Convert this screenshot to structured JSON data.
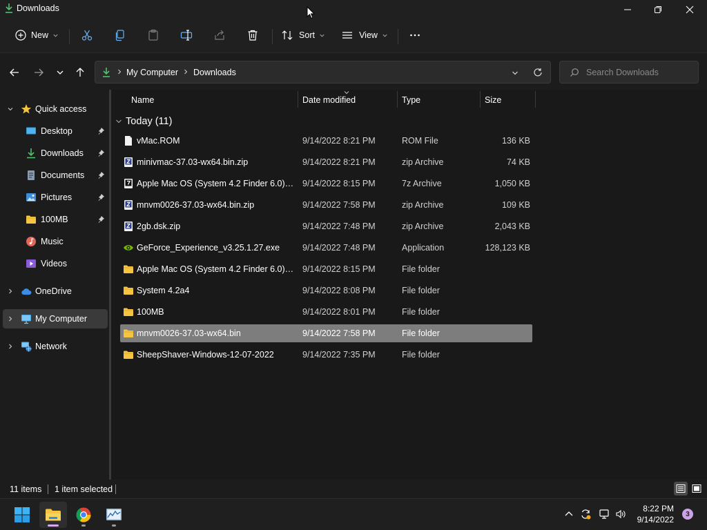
{
  "window": {
    "title": "Downloads"
  },
  "toolbar": {
    "new_label": "New",
    "sort_label": "Sort",
    "view_label": "View"
  },
  "address": {
    "crumbs": [
      "My Computer",
      "Downloads"
    ],
    "search_placeholder": "Search Downloads"
  },
  "sidebar": {
    "items": [
      {
        "label": "Quick access",
        "icon": "star-icon"
      },
      {
        "label": "Desktop",
        "icon": "desktop-icon",
        "pinned": true
      },
      {
        "label": "Downloads",
        "icon": "download-icon",
        "pinned": true
      },
      {
        "label": "Documents",
        "icon": "document-icon",
        "pinned": true
      },
      {
        "label": "Pictures",
        "icon": "pictures-icon",
        "pinned": true
      },
      {
        "label": "100MB",
        "icon": "folder-icon",
        "pinned": true
      },
      {
        "label": "Music",
        "icon": "music-icon"
      },
      {
        "label": "Videos",
        "icon": "videos-icon"
      },
      {
        "label": "OneDrive",
        "icon": "cloud-icon"
      },
      {
        "label": "My Computer",
        "icon": "computer-icon",
        "selected": true
      },
      {
        "label": "Network",
        "icon": "network-icon"
      }
    ]
  },
  "columns": {
    "name": "Name",
    "date": "Date modified",
    "type": "Type",
    "size": "Size"
  },
  "group": {
    "label": "Today (11)"
  },
  "files": [
    {
      "name": "vMac.ROM",
      "date": "9/14/2022 8:21 PM",
      "type": "ROM File",
      "size": "136 KB",
      "icon": "file-icon"
    },
    {
      "name": "minivmac-37.03-wx64.bin.zip",
      "date": "9/14/2022 8:21 PM",
      "type": "zip Archive",
      "size": "74 KB",
      "icon": "zip-icon"
    },
    {
      "name": "Apple Mac OS (System 4.2 Finder 6.0) (Sy...",
      "date": "9/14/2022 8:15 PM",
      "type": "7z Archive",
      "size": "1,050 KB",
      "icon": "7z-icon"
    },
    {
      "name": "mnvm0026-37.03-wx64.bin.zip",
      "date": "9/14/2022 7:58 PM",
      "type": "zip Archive",
      "size": "109 KB",
      "icon": "zip-icon"
    },
    {
      "name": "2gb.dsk.zip",
      "date": "9/14/2022 7:48 PM",
      "type": "zip Archive",
      "size": "2,043 KB",
      "icon": "zip-icon"
    },
    {
      "name": "GeForce_Experience_v3.25.1.27.exe",
      "date": "9/14/2022 7:48 PM",
      "type": "Application",
      "size": "128,123 KB",
      "icon": "nvidia-icon"
    },
    {
      "name": "Apple Mac OS (System 4.2 Finder 6.0) (Sy...",
      "date": "9/14/2022 8:15 PM",
      "type": "File folder",
      "size": "",
      "icon": "folder-icon"
    },
    {
      "name": "System 4.2a4",
      "date": "9/14/2022 8:08 PM",
      "type": "File folder",
      "size": "",
      "icon": "folder-icon"
    },
    {
      "name": "100MB",
      "date": "9/14/2022 8:01 PM",
      "type": "File folder",
      "size": "",
      "icon": "folder-icon"
    },
    {
      "name": "mnvm0026-37.03-wx64.bin",
      "date": "9/14/2022 7:58 PM",
      "type": "File folder",
      "size": "",
      "icon": "folder-icon",
      "selected": true
    },
    {
      "name": "SheepShaver-Windows-12-07-2022",
      "date": "9/14/2022 7:35 PM",
      "type": "File folder",
      "size": "",
      "icon": "folder-icon"
    }
  ],
  "status": {
    "item_count": "11 items",
    "selection": "1 item selected"
  },
  "taskbar": {
    "time": "8:22 PM",
    "date": "9/14/2022",
    "notifications": "3"
  },
  "colors": {
    "folder": "#f5c542",
    "download_accent": "#4fc36a",
    "selection": "#7d7d7d"
  }
}
